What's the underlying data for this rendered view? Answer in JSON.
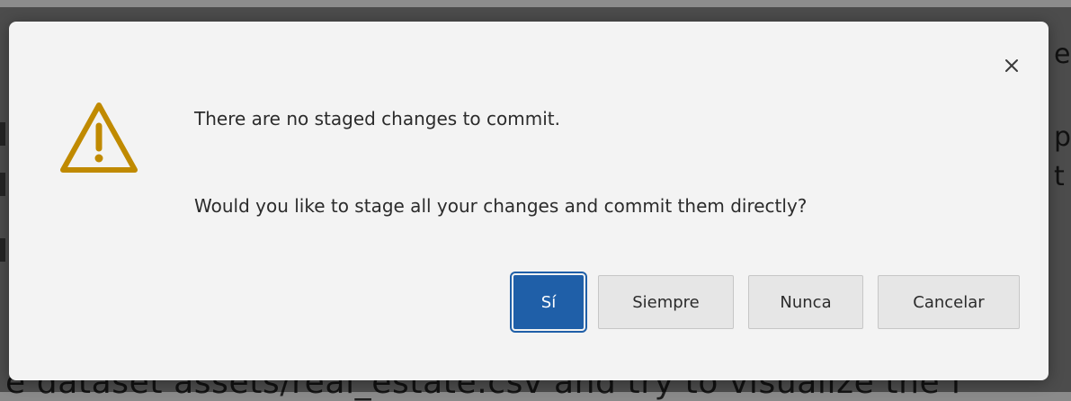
{
  "background": {
    "bottom_text": "e dataset assets/real_estate.csv and try to visualize the f",
    "right_texts": [
      "et",
      "pa",
      "t"
    ]
  },
  "dialog": {
    "messages": [
      "There are no staged changes to commit.",
      "Would you like to stage all your changes and commit them directly?"
    ],
    "buttons": [
      {
        "label": "Sí",
        "variant": "primary"
      },
      {
        "label": "Siempre",
        "variant": "secondary"
      },
      {
        "label": "Nunca",
        "variant": "secondary"
      },
      {
        "label": "Cancelar",
        "variant": "secondary"
      }
    ],
    "close_icon": "close-icon",
    "warning_icon": "warning-triangle-icon"
  },
  "colors": {
    "dialog_background": "#f3f3f3",
    "primary": "#1f5fa8",
    "warning": "#c08a00",
    "text": "#2b2b2b"
  }
}
